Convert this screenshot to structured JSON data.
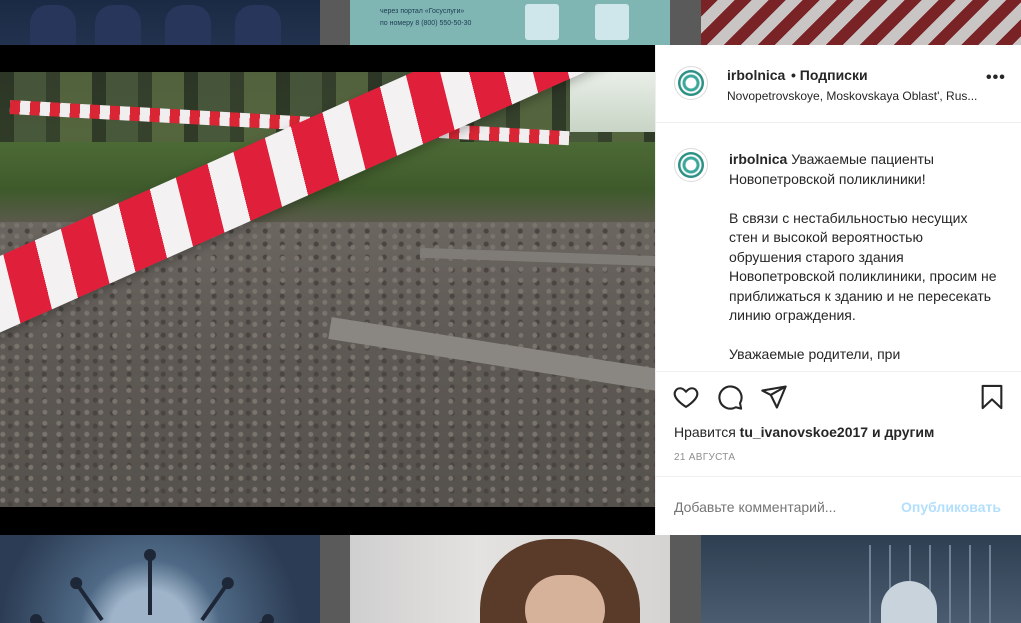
{
  "background": {
    "tile_top_2_lines": [
      "через портал «Госуслуги»",
      "по номеру 8 (800) 550-50-30"
    ]
  },
  "post": {
    "username": "irbolnica",
    "follow_label": "• Подписки",
    "location": "Novopetrovskoye, Moskovskaya Oblast', Rus...",
    "more_icon": "•••",
    "caption_username": "irbolnica",
    "caption_text": " Уважаемые пациенты Новопетровской поликлиники!\n\nВ связи с нестабильностью несущих стен и высокой вероятностью обрушения старого здания Новопетровской поликлиники, просим не приближаться к зданию и не пересекать линию ограждения.\n\nУважаемые родители, при",
    "likes_prefix": "Нравится ",
    "likes_user": "tu_ivanovskoe2017",
    "likes_suffix": " и другим",
    "date": "21 АВГУСТА",
    "comment_placeholder": "Добавьте комментарий...",
    "publish_label": "Опубликовать"
  },
  "icons": {
    "like": "heart-icon",
    "comment": "comment-icon",
    "share": "share-icon",
    "save": "bookmark-icon"
  },
  "colors": {
    "tape_red": "#e0203a",
    "text": "#262626",
    "muted": "#8e8e8e",
    "publish_disabled": "#b2dffc"
  }
}
